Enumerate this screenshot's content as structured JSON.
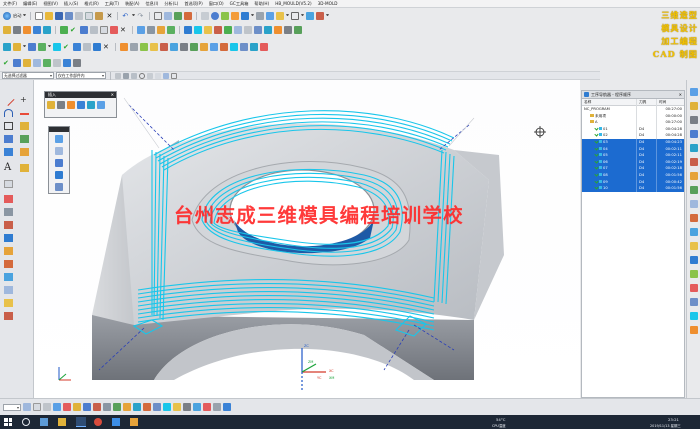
{
  "menu": [
    "文件(F)",
    "编辑(E)",
    "视图(V)",
    "插入(S)",
    "格式(R)",
    "工具(T)",
    "装配(A)",
    "信息(I)",
    "分析(L)",
    "首选项(P)",
    "窗口(O)",
    "GC工具箱",
    "帮助(H)",
    "HB_MOULD(V5.2)",
    "3D-MOLD"
  ],
  "toolbar": {
    "start_label": "启动"
  },
  "brand": [
    "三维造型",
    "模具设计",
    "加工编程",
    "CAD 制图"
  ],
  "selection": {
    "filter": "无选择过滤器",
    "scope": "仅在工作部件内"
  },
  "insert_palette": {
    "title": "插入"
  },
  "watermark": "台州志成三维模具编程培训学校",
  "navigator": {
    "title": "工序导航器 - 程序顺序",
    "columns": [
      "名称",
      "刀具",
      "时间"
    ],
    "rows": [
      {
        "name": "NC_PROGRAM",
        "tool": "",
        "time": "00:27:00",
        "sel": false,
        "indent": 0,
        "kind": "root"
      },
      {
        "name": "未用项",
        "tool": "",
        "time": "00:00:00",
        "sel": false,
        "indent": 1,
        "kind": "folder"
      },
      {
        "name": "A",
        "tool": "",
        "time": "00:27:00",
        "sel": false,
        "indent": 1,
        "kind": "folder"
      },
      {
        "name": "01",
        "tool": "D4",
        "time": "00:04:28",
        "sel": false,
        "indent": 2,
        "kind": "op"
      },
      {
        "name": "02",
        "tool": "D4",
        "time": "00:04:28",
        "sel": false,
        "indent": 2,
        "kind": "op"
      },
      {
        "name": "03",
        "tool": "D4",
        "time": "00:04:23",
        "sel": true,
        "indent": 2,
        "kind": "op"
      },
      {
        "name": "04",
        "tool": "D4",
        "time": "00:02:11",
        "sel": true,
        "indent": 2,
        "kind": "op"
      },
      {
        "name": "05",
        "tool": "D4",
        "time": "00:02:11",
        "sel": true,
        "indent": 2,
        "kind": "op"
      },
      {
        "name": "06",
        "tool": "D4",
        "time": "00:02:19",
        "sel": true,
        "indent": 2,
        "kind": "op"
      },
      {
        "name": "07",
        "tool": "D4",
        "time": "00:02:18",
        "sel": true,
        "indent": 2,
        "kind": "op"
      },
      {
        "name": "08",
        "tool": "D4",
        "time": "00:01:56",
        "sel": true,
        "indent": 2,
        "kind": "op"
      },
      {
        "name": "09",
        "tool": "D4",
        "time": "00:00:42",
        "sel": true,
        "indent": 2,
        "kind": "op"
      },
      {
        "name": "10",
        "tool": "D4",
        "time": "00:01:56",
        "sel": true,
        "indent": 2,
        "kind": "op"
      }
    ]
  },
  "axes": {
    "x": "XC",
    "y": "YC",
    "z": "ZC",
    "x2": "XM",
    "y2": "YM",
    "z2": "ZM"
  },
  "taskbar": {
    "tray_temp": "54°C",
    "tray_cpu": "CPU温度",
    "clock": "23:21",
    "date": "2019/11/13 星期三"
  },
  "colors": {
    "toolpath": "#19c6ea",
    "selected": "#1c6bd0",
    "part": "#c9ccd1",
    "brand": "#f2c200",
    "watermark": "#ff2a2a"
  }
}
